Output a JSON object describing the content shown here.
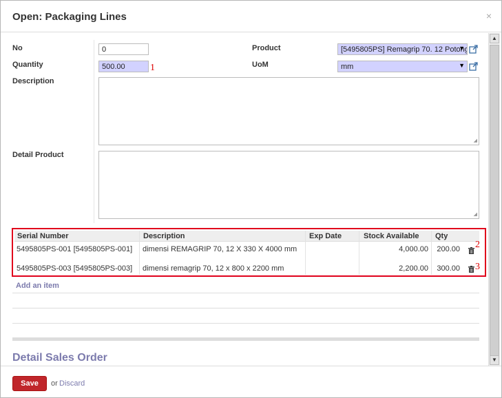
{
  "dialog": {
    "title": "Open: Packaging Lines",
    "close_label": "×"
  },
  "form": {
    "no_label": "No",
    "no_value": "0",
    "quantity_label": "Quantity",
    "quantity_value": "500.00",
    "product_label": "Product",
    "product_value": "[5495805PS] Remagrip 70. 12 Potong",
    "uom_label": "UoM",
    "uom_value": "mm",
    "description_label": "Description",
    "detail_product_label": "Detail Product"
  },
  "annotations": [
    "1",
    "2",
    "3"
  ],
  "table": {
    "columns": [
      "Serial Number",
      "Description",
      "Exp Date",
      "Stock Available",
      "Qty"
    ],
    "rows": [
      {
        "serial": "5495805PS-001 [5495805PS-001]",
        "description": "dimensi REMAGRIP 70, 12 X 330 X 4000 mm",
        "exp_date": "",
        "stock": "4,000.00",
        "qty": "200.00"
      },
      {
        "serial": "5495805PS-003 [5495805PS-003]",
        "description": "dimensi remagrip 70, 12 x 800 x 2200 mm",
        "exp_date": "",
        "stock": "2,200.00",
        "qty": "300.00"
      }
    ],
    "add_item_label": "Add an item"
  },
  "section": {
    "title": "Detail Sales Order"
  },
  "footer": {
    "save_label": "Save",
    "or_label": "or",
    "discard_label": "Discard"
  },
  "colors": {
    "accent": "#7c7bad",
    "save": "#c0262b",
    "required_bg": "#d2d2ff",
    "highlight": "#e0001b"
  }
}
